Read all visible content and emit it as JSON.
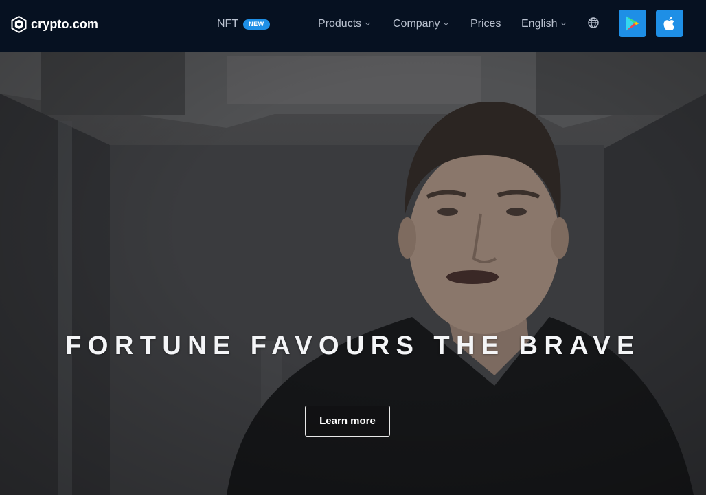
{
  "header": {
    "logo_text": "crypto.com",
    "nft": {
      "label": "NFT",
      "badge": "NEW"
    },
    "nav": {
      "products": "Products",
      "company": "Company",
      "prices": "Prices",
      "language": "English"
    },
    "icons": {
      "logo": "crypto-com-logo-icon",
      "globe": "globe-icon",
      "google_play": "google-play-icon",
      "apple": "apple-icon"
    }
  },
  "hero": {
    "headline": "FORTUNE FAVOURS THE BRAVE",
    "cta_label": "Learn more"
  },
  "colors": {
    "header_bg": "#061121",
    "accent": "#1e8fe6",
    "nav_text": "#b9c1cf"
  }
}
